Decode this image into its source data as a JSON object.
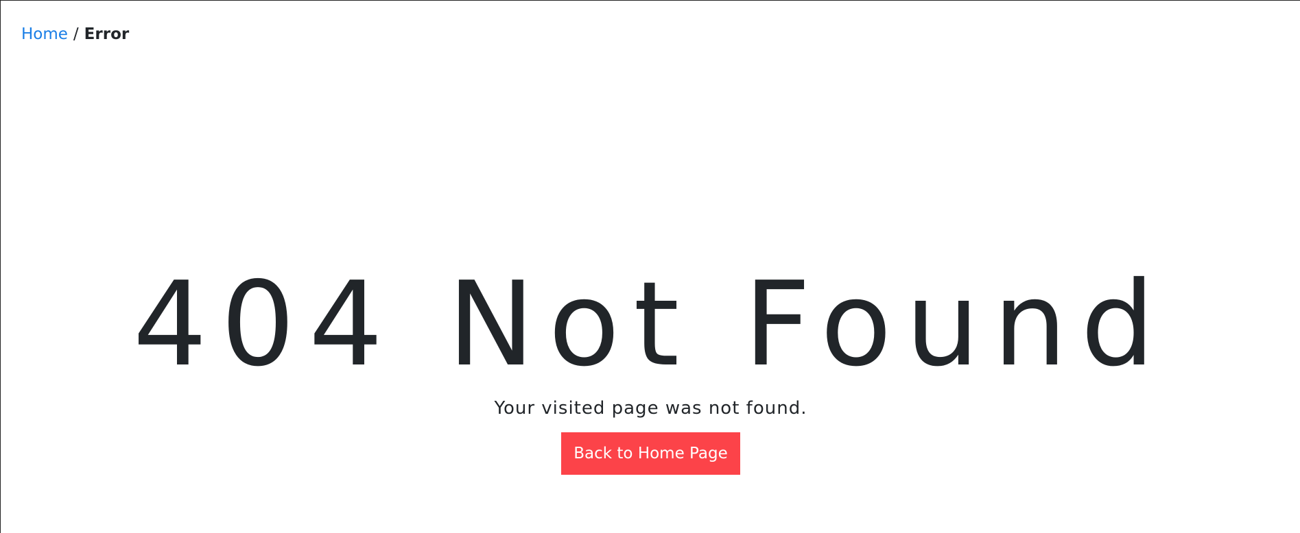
{
  "breadcrumb": {
    "home_label": "Home",
    "separator": "/",
    "current_label": "Error"
  },
  "error": {
    "title": "404 Not Found",
    "message": "Your visited page was not found.",
    "button_label": "Back to Home Page"
  },
  "colors": {
    "link": "#1a7ee6",
    "text": "#212529",
    "button_bg": "#fc4349",
    "button_text": "#ffffff",
    "background": "#ffffff"
  }
}
